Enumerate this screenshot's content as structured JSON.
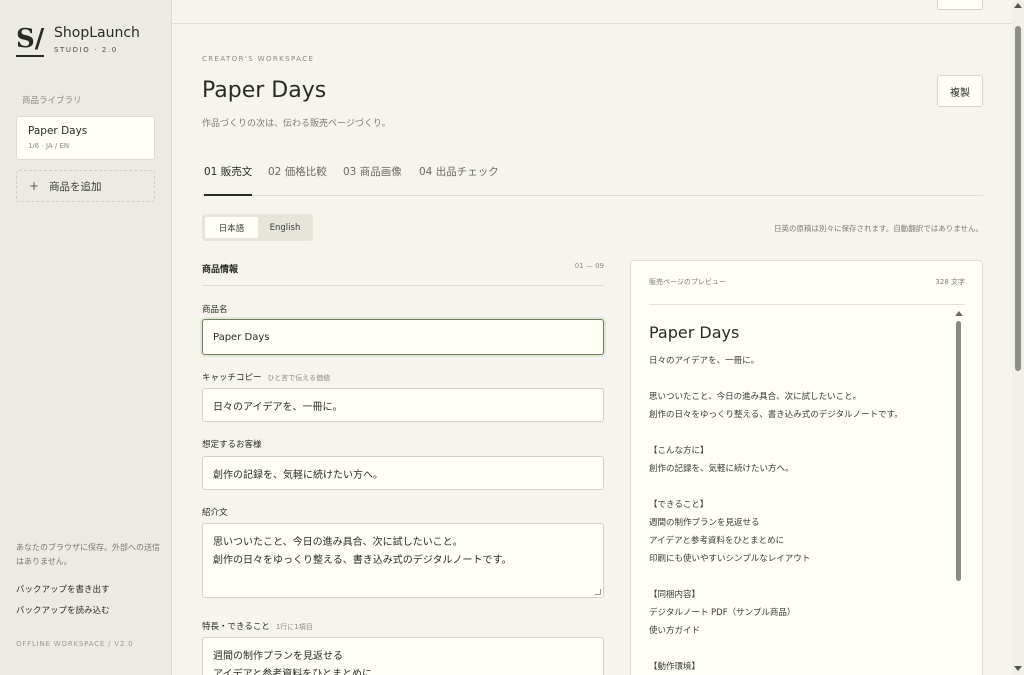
{
  "brand": {
    "mark": "S/",
    "name": "ShopLaunch",
    "sub": "STUDIO · 2.0"
  },
  "sidebar": {
    "library_label": "商品ライブラリ",
    "product": {
      "name": "Paper Days",
      "meta": "1/6 · JA / EN"
    },
    "add_label": "商品を追加",
    "note": "あなたのブラウザに保存。外部への送信はありません。",
    "backup_export": "バックアップを書き出す",
    "backup_import": "バックアップを読み込む",
    "footer": "OFFLINE WORKSPACE / V2.0"
  },
  "header": {
    "eyebrow": "CREATOR'S WORKSPACE",
    "title": "Paper Days",
    "subtitle": "作品づくりの次は、伝わる販売ページづくり。",
    "copy_button": "複製"
  },
  "tabs": [
    {
      "label": "01 販売文"
    },
    {
      "label": "02 価格比較"
    },
    {
      "label": "03 商品画像"
    },
    {
      "label": "04 出品チェック"
    }
  ],
  "language": {
    "ja": "日本語",
    "en": "English",
    "note": "日英の原稿は別々に保存されます。自動翻訳ではありません。"
  },
  "section": {
    "title": "商品情報",
    "range": "01 — 09"
  },
  "fields": {
    "name": {
      "label": "商品名",
      "value": "Paper Days"
    },
    "catch": {
      "label": "キャッチコピー",
      "hint": "ひと言で伝える価値",
      "value": "日々のアイデアを、一冊に。"
    },
    "audience": {
      "label": "想定するお客様",
      "value": "創作の記録を、気軽に続けたい方へ。"
    },
    "intro": {
      "label": "紹介文",
      "value": "思いついたこと、今日の進み具合、次に試したいこと。\n創作の日々をゆっくり整える、書き込み式のデジタルノートです。"
    },
    "features": {
      "label": "特長・できること",
      "hint": "1行に1項目",
      "value": "週間の制作プランを見返せる\nアイデアと参考資料をひとまとめに"
    }
  },
  "preview": {
    "label": "販売ページのプレビュー",
    "count": "328 文字",
    "title": "Paper Days",
    "lines": [
      "日々のアイデアを、一冊に。",
      "",
      "思いついたこと、今日の進み具合、次に試したいこと。",
      "創作の日々をゆっくり整える、書き込み式のデジタルノートです。",
      "",
      "【こんな方に】",
      "創作の記録を、気軽に続けたい方へ。",
      "",
      "【できること】",
      "週間の制作プランを見返せる",
      "アイデアと参考資料をひとまとめに",
      "印刷にも使いやすいシンプルなレイアウト",
      "",
      "【同梱内容】",
      "デジタルノート PDF（サンプル商品）",
      "使い方ガイド",
      "",
      "【動作環境】"
    ]
  }
}
